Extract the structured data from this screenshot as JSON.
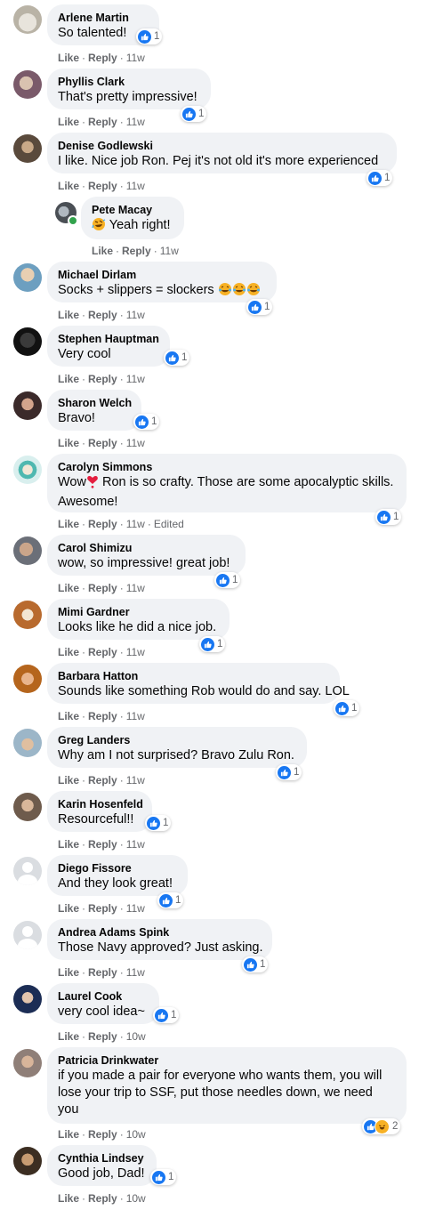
{
  "actions": {
    "like": "Like",
    "reply": "Reply",
    "separator": "·"
  },
  "colors": {
    "bubble": "#f0f2f5",
    "like_blue": "#1877f2",
    "meta_gray": "#65676b",
    "online_green": "#31a24c"
  },
  "comments": [
    {
      "author": "Arlene Martin",
      "text": "So talented!",
      "time": "11w",
      "reaction_count": "1"
    },
    {
      "author": "Phyllis Clark",
      "text": "That's pretty impressive!",
      "time": "11w",
      "reaction_count": "1"
    },
    {
      "author": "Denise Godlewski",
      "text": "I like. Nice job Ron. Pej it's not old it's more experienced",
      "time": "11w",
      "reaction_count": "1"
    },
    {
      "author": "Pete Macay",
      "text": "Yeah right!",
      "time": "11w",
      "reaction_count": "",
      "emoji": "rolling-on-floor-laughing-emoji"
    },
    {
      "author": "Michael Dirlam",
      "text": "Socks + slippers = slockers",
      "time": "11w",
      "reaction_count": "1",
      "emoji": "tears-of-joy-emoji x3"
    },
    {
      "author": "Stephen Hauptman",
      "text": "Very cool",
      "time": "11w",
      "reaction_count": "1"
    },
    {
      "author": "Sharon Welch",
      "text": "Bravo!",
      "time": "11w",
      "reaction_count": "1"
    },
    {
      "author": "Carolyn Simmons",
      "text_before": "Wow",
      "text_after": " Ron is so crafty. Those are some apocalyptic skills. Awesome!",
      "time": "11w",
      "edited": "Edited",
      "reaction_count": "1",
      "emoji": "red-heart-exclamation-emoji"
    },
    {
      "author": "Carol Shimizu",
      "text": "wow, so impressive! great job!",
      "time": "11w",
      "reaction_count": "1"
    },
    {
      "author": "Mimi Gardner",
      "text": "Looks like he did a nice job.",
      "time": "11w",
      "reaction_count": "1"
    },
    {
      "author": "Barbara Hatton",
      "text": "Sounds like something Rob would do and say. LOL",
      "time": "11w",
      "reaction_count": "1"
    },
    {
      "author": "Greg Landers",
      "text": "Why am I not surprised? Bravo Zulu Ron.",
      "time": "11w",
      "reaction_count": "1"
    },
    {
      "author": "Karin Hosenfeld",
      "text": "Resourceful!!",
      "time": "11w",
      "reaction_count": "1"
    },
    {
      "author": "Diego Fissore",
      "text": "And they look great!",
      "time": "11w",
      "reaction_count": "1"
    },
    {
      "author": "Andrea Adams Spink",
      "text": "Those Navy approved? Just asking.",
      "time": "11w",
      "reaction_count": "1"
    },
    {
      "author": "Laurel Cook",
      "text": "very cool idea~",
      "time": "10w",
      "reaction_count": "1"
    },
    {
      "author": "Patricia Drinkwater",
      "text": "if you made a pair for everyone who wants them, you will lose your trip to SSF, put those needles down, we need you",
      "time": "10w",
      "reaction_count": "2"
    },
    {
      "author": "Cynthia Lindsey",
      "text": "Good job, Dad!",
      "time": "10w",
      "reaction_count": "1"
    }
  ]
}
